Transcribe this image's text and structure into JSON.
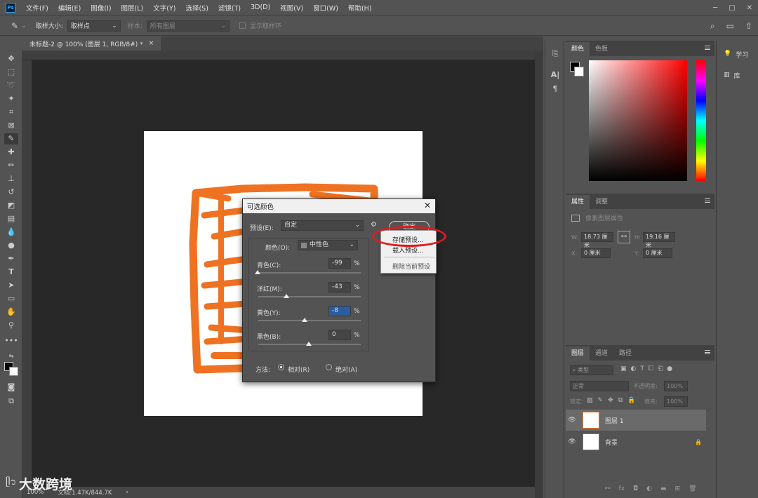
{
  "app": {
    "logo": "Ps"
  },
  "menu": [
    "文件(F)",
    "编辑(E)",
    "图像(I)",
    "图层(L)",
    "文字(Y)",
    "选择(S)",
    "滤镜(T)",
    "3D(D)",
    "视图(V)",
    "窗口(W)",
    "帮助(H)"
  ],
  "options": {
    "sample_size_label": "取样大小:",
    "sample_size_value": "取样点",
    "sample_label": "样本:",
    "sample_value": "所有图层",
    "show_ring_label": "显示取样环"
  },
  "document": {
    "tab": "未标题-2 @ 100% (图层 1, RGB/8#) *",
    "zoom": "100%",
    "doc_info": "文档:1.47K/844.7K"
  },
  "panels": {
    "color_tabs": [
      "颜色",
      "色板"
    ],
    "props_tabs": [
      "属性",
      "调整"
    ],
    "props_title": "像素图层属性",
    "props": {
      "w_label": "W:",
      "w": "18.73 厘米",
      "h_label": "H:",
      "h": "19.16 厘米",
      "x_label": "X:",
      "x": "0 厘米",
      "y_label": "Y:",
      "y": "0 厘米"
    },
    "layers_tabs": [
      "图层",
      "通道",
      "路径"
    ],
    "layers_filter": "类型",
    "blend_mode": "正常",
    "opacity_label": "不透明度:",
    "opacity": "100%",
    "lock_label": "锁定:",
    "fill_label": "填充:",
    "fill": "100%",
    "layers": [
      {
        "name": "图层 1"
      },
      {
        "name": "背景"
      }
    ],
    "learn": "学习",
    "library": "库"
  },
  "dialog": {
    "title": "可选颜色",
    "preset_label": "预设(E):",
    "preset_value": "自定",
    "ok_label": "确定",
    "colors_label": "颜色(O):",
    "colors_value": "中性色",
    "sliders": [
      {
        "label": "青色(C):",
        "value": "-99",
        "pct": "%"
      },
      {
        "label": "洋红(M):",
        "value": "-43",
        "pct": "%"
      },
      {
        "label": "黄色(Y):",
        "value": "-8",
        "pct": "%"
      },
      {
        "label": "黑色(B):",
        "value": "0",
        "pct": "%"
      }
    ],
    "method_label": "方法:",
    "relative_label": "相对(R)",
    "absolute_label": "绝对(A)",
    "menu_items": [
      "存储预设...",
      "载入预设...",
      "删除当前预设"
    ]
  },
  "watermark": {
    "mark": "ᥫ᭡",
    "text": "大数跨境"
  },
  "colors": {
    "accent_red": "#e31a1c",
    "stamp_orange": "#ee7221"
  }
}
